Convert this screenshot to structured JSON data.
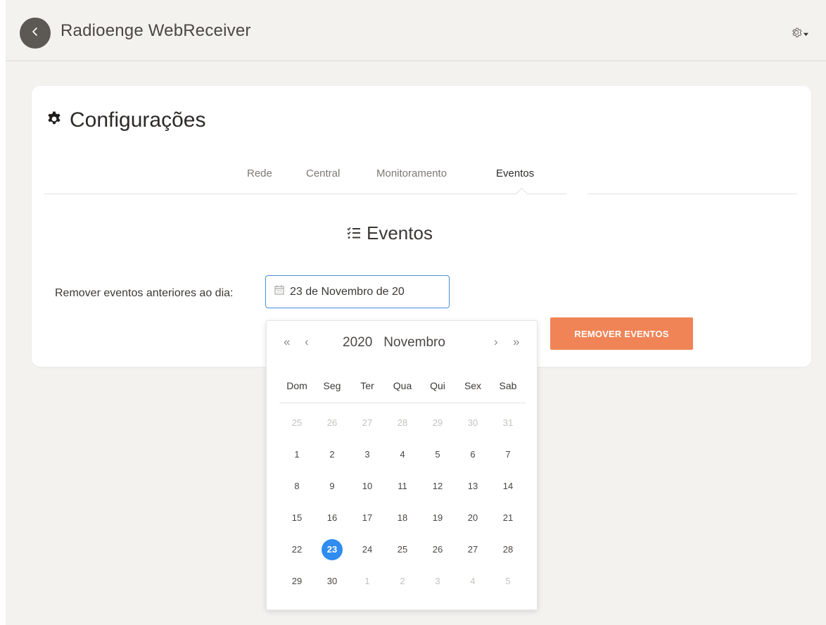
{
  "header": {
    "title": "Radioenge WebReceiver"
  },
  "card": {
    "title": "Configurações",
    "tabs": [
      {
        "label": "Rede"
      },
      {
        "label": "Central"
      },
      {
        "label": "Monitoramento"
      },
      {
        "label": "Eventos",
        "active": true
      }
    ],
    "section_title": "Eventos",
    "remove_label": "Remover eventos anteriores ao dia:",
    "date_value": "23 de Novembro de 20",
    "remove_button": "REMOVER EVENTOS"
  },
  "calendar": {
    "year": "2020",
    "month": "Novembro",
    "nav": {
      "prev_year": "«",
      "prev_month": "‹",
      "next_month": "›",
      "next_year": "»"
    },
    "weekdays": [
      "Dom",
      "Seg",
      "Ter",
      "Qua",
      "Qui",
      "Sex",
      "Sab"
    ],
    "weeks": [
      [
        "25",
        "26",
        "27",
        "28",
        "29",
        "30",
        "31"
      ],
      [
        "1",
        "2",
        "3",
        "4",
        "5",
        "6",
        "7"
      ],
      [
        "8",
        "9",
        "10",
        "11",
        "12",
        "13",
        "14"
      ],
      [
        "15",
        "16",
        "17",
        "18",
        "19",
        "20",
        "21"
      ],
      [
        "22",
        "23",
        "24",
        "25",
        "26",
        "27",
        "28"
      ],
      [
        "29",
        "30",
        "1",
        "2",
        "3",
        "4",
        "5"
      ]
    ],
    "muted": [
      [
        true,
        true,
        true,
        true,
        true,
        true,
        true
      ],
      [
        false,
        false,
        false,
        false,
        false,
        false,
        false
      ],
      [
        false,
        false,
        false,
        false,
        false,
        false,
        false
      ],
      [
        false,
        false,
        false,
        false,
        false,
        false,
        false
      ],
      [
        false,
        false,
        false,
        false,
        false,
        false,
        false
      ],
      [
        false,
        false,
        true,
        true,
        true,
        true,
        true
      ]
    ],
    "selected_day": "23"
  },
  "colors": {
    "accent_button": "#f08456",
    "selected_day": "#2f8cf0",
    "input_border": "#4a90d9",
    "background": "#f3f2ef"
  },
  "icons": {
    "back": "chevron-left-icon",
    "settings": "gear-icon",
    "title": "cog-icon",
    "section": "checklist-icon",
    "date": "calendar-icon"
  }
}
